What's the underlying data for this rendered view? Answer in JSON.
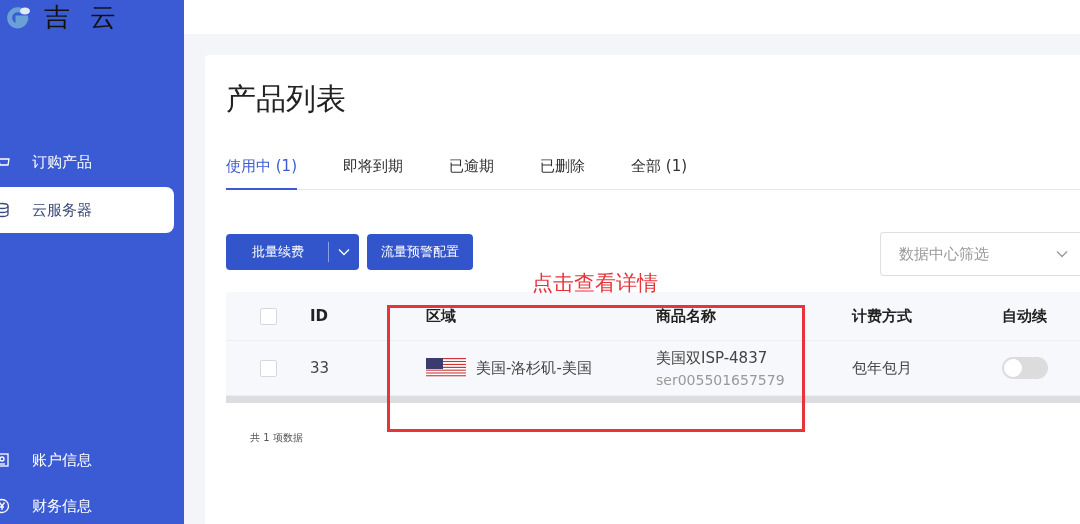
{
  "sidebar": {
    "logo_text": "吉 云",
    "items": [
      {
        "label": "订购产品",
        "kind": "cart",
        "selected": false
      },
      {
        "label": "云服务器",
        "kind": "database",
        "selected": true
      }
    ],
    "bottom_items": [
      {
        "label": "账户信息",
        "kind": "profile",
        "selected": false
      },
      {
        "label": "财务信息",
        "kind": "yen",
        "selected": false
      }
    ]
  },
  "page_title": "产品列表",
  "tabs": [
    {
      "label": "使用中 (1)",
      "selected": true
    },
    {
      "label": "即将到期",
      "selected": false
    },
    {
      "label": "已逾期",
      "selected": false
    },
    {
      "label": "已删除",
      "selected": false
    },
    {
      "label": "全部 (1)",
      "selected": false
    }
  ],
  "toolbar": {
    "renew_button": "批量续费",
    "alert_button": "流量预警配置",
    "filter": {
      "placeholder": "数据中心筛选"
    }
  },
  "table": {
    "header_checked": false,
    "columns": [
      "ID",
      "区域",
      "商品名称",
      "计费方式",
      "自动续"
    ],
    "rows": [
      {
        "checked": false,
        "id": "33",
        "region": "美国-洛杉矶-美国",
        "name": "美国双ISP-4837",
        "serial": "ser005501657579",
        "billing": "包年包月",
        "auto_renew": false
      }
    ]
  },
  "total": "共 1 项数据",
  "annotation": {
    "text": "点击查看详情"
  }
}
